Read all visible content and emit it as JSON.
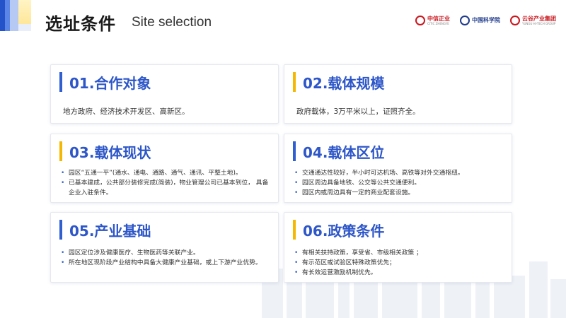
{
  "header": {
    "title_cn": "选址条件",
    "title_en": "Site selection",
    "logos": [
      {
        "cn": "中信正业",
        "en": "CITIC ZHENGYE"
      },
      {
        "cn": "中国科学院",
        "en": ""
      },
      {
        "cn": "云谷产业集团",
        "en": "YUNGU HI-TECH GROUP"
      }
    ]
  },
  "colors": {
    "accent_blue": "#2d56c8",
    "accent_yellow": "#f5b800"
  },
  "cards": [
    {
      "title": "01.合作对象",
      "text": "地方政府、经济技术开发区、高新区。"
    },
    {
      "title": "02.载体规模",
      "text": "政府载体，3万平米以上，证照齐全。"
    },
    {
      "title": "03.载体现状",
      "items": [
        "园区“五通一平”(通水、通电、通路、通气、通讯、平整土地)。",
        "已基本建成，公共部分装修完成(简装)，物业管理公司已基本到位， 具备企业入驻条件。"
      ]
    },
    {
      "title": "04.载体区位",
      "items": [
        "交通通达性较好，半小时可达机场、高铁等对外交通枢纽。",
        "园区周边具备地铁、公交等公共交通便利。",
        "园区内或周边具有一定的商业配套设施。"
      ]
    },
    {
      "title": "05.产业基础",
      "items": [
        "园区定位涉及健康医疗、生物医药等关联产业。",
        "所在地区现阶段产业结构中具备大健康产业基础，或上下游产业优势。"
      ]
    },
    {
      "title": "06.政策条件",
      "items": [
        "有相关扶持政策，享受省、市级相关政策 ；",
        "有示范区或试验区特殊政策优先；",
        "有长效运营激励机制优先。"
      ]
    }
  ]
}
